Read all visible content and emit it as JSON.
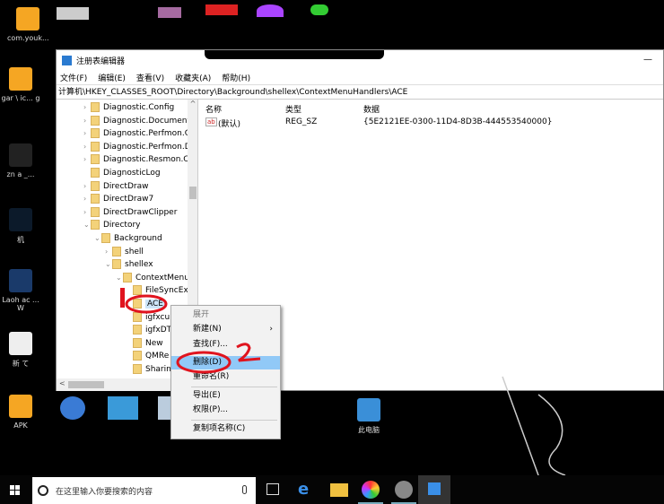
{
  "desktop": {
    "icons": [
      {
        "label": "com.youk...",
        "color": "#f5a623"
      },
      {
        "label": "gar  \\ ic... g",
        "color": "#f5a623"
      },
      {
        "label": "zn   a _...",
        "color": "#333"
      },
      {
        "label": "机",
        "color": "#123"
      },
      {
        "label": "Laoh ac  ... W",
        "color": "#1a3a6a"
      },
      {
        "label": "新     て",
        "color": "#eee"
      },
      {
        "label": "APK",
        "color": "#f5a623"
      }
    ],
    "this_pc": "此电脑"
  },
  "window": {
    "title": "注册表编辑器",
    "menu": [
      "文件(F)",
      "编辑(E)",
      "查看(V)",
      "收藏夹(A)",
      "帮助(H)"
    ],
    "address": "计算机\\HKEY_CLASSES_ROOT\\Directory\\Background\\shellex\\ContextMenuHandlers\\ACE",
    "tree": [
      {
        "label": "Diagnostic.Config",
        "level": 1,
        "exp": ">"
      },
      {
        "label": "Diagnostic.Document",
        "level": 1,
        "exp": ">"
      },
      {
        "label": "Diagnostic.Perfmon.C",
        "level": 1,
        "exp": ">"
      },
      {
        "label": "Diagnostic.Perfmon.D",
        "level": 1,
        "exp": ">"
      },
      {
        "label": "Diagnostic.Resmon.C",
        "level": 1,
        "exp": ">"
      },
      {
        "label": "DiagnosticLog",
        "level": 1,
        "exp": ""
      },
      {
        "label": "DirectDraw",
        "level": 1,
        "exp": ">"
      },
      {
        "label": "DirectDraw7",
        "level": 1,
        "exp": ">"
      },
      {
        "label": "DirectDrawClipper",
        "level": 1,
        "exp": ">"
      },
      {
        "label": "Directory",
        "level": 1,
        "exp": "v"
      },
      {
        "label": "Background",
        "level": 2,
        "exp": "v"
      },
      {
        "label": "shell",
        "level": 3,
        "exp": ">"
      },
      {
        "label": "shellex",
        "level": 3,
        "exp": "v"
      },
      {
        "label": "ContextMenu",
        "level": 4,
        "exp": "v"
      },
      {
        "label": "FileSyncEx",
        "level": 5,
        "exp": ""
      },
      {
        "label": "ACE",
        "level": 5,
        "exp": "",
        "selected": true
      },
      {
        "label": "igfxcu",
        "level": 5,
        "exp": ""
      },
      {
        "label": "igfxDT",
        "level": 5,
        "exp": ""
      },
      {
        "label": "New",
        "level": 5,
        "exp": ""
      },
      {
        "label": "QMRe",
        "level": 5,
        "exp": ""
      },
      {
        "label": "Sharin",
        "level": 5,
        "exp": ""
      }
    ],
    "list": {
      "columns": [
        "名称",
        "类型",
        "数据"
      ],
      "rows": [
        {
          "name": "(默认)",
          "type": "REG_SZ",
          "data": "{5E2121EE-0300-11D4-8D3B-444553540000}",
          "icon": "ab"
        }
      ]
    }
  },
  "context_menu": {
    "items": [
      {
        "label": "展开",
        "disabled": true
      },
      {
        "label": "新建(N)",
        "submenu": true
      },
      {
        "label": "查找(F)..."
      },
      {
        "label": "删除(D)",
        "highlighted": true
      },
      {
        "label": "重命名(R)"
      },
      {
        "label": "导出(E)"
      },
      {
        "label": "权限(P)..."
      },
      {
        "label": "复制项名称(C)"
      }
    ]
  },
  "annotations": {
    "step1": "1",
    "step2": "2",
    "color": "#e0141e"
  },
  "taskbar": {
    "search_placeholder": "在这里输入你要搜索的内容"
  }
}
